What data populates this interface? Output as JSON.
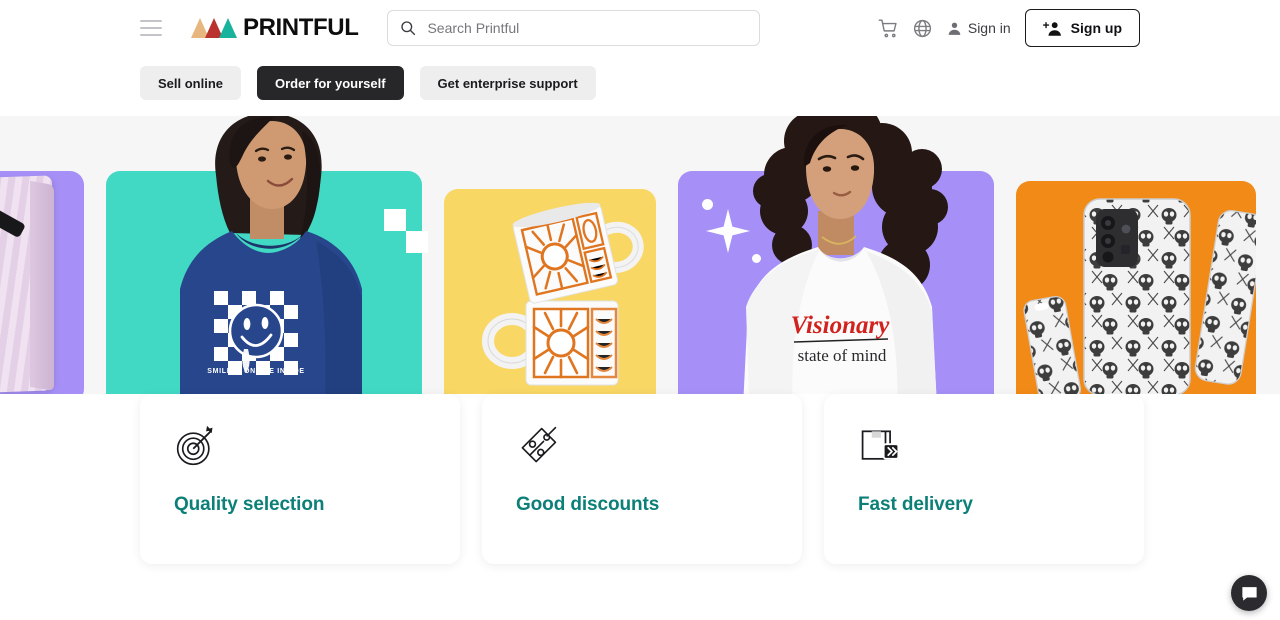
{
  "header": {
    "menu_icon": "hamburger-menu-icon",
    "brand": "PRINTFUL",
    "logo_colors": [
      "#e8b77f",
      "#b9322e",
      "#18b39c"
    ],
    "search": {
      "icon": "search-icon",
      "placeholder": "Search Printful",
      "value": ""
    },
    "cart_icon": "shopping-cart-icon",
    "globe_icon": "globe-icon",
    "sign_in": {
      "label": "Sign in",
      "icon": "user-icon"
    },
    "sign_up": {
      "label": "Sign up",
      "icon": "user-plus-icon"
    }
  },
  "tabs": [
    {
      "label": "Sell online",
      "active": false
    },
    {
      "label": "Order for yourself",
      "active": true
    },
    {
      "label": "Get enterprise support",
      "active": false
    }
  ],
  "carousel": {
    "items": [
      {
        "name": "tote-bag",
        "product": "Wavy pink tote bag with black straps",
        "bg_color": "#a690f7"
      },
      {
        "name": "smiley-sweatshirt",
        "product": "Navy sweatshirt with checkered melting smiley",
        "print_text": "SMILING ON THE INSIDE",
        "bg_color": "#41d9c4"
      },
      {
        "name": "sun-mugs",
        "product": "Stacked white mugs with orange sun print",
        "bg_color": "#f8d765"
      },
      {
        "name": "visionary-sweatshirt",
        "product": "White sweatshirt worn by model",
        "print_line1": "Visionary",
        "print_line2": "state of mind",
        "bg_color": "#a690f7"
      },
      {
        "name": "skull-phone-case",
        "product": "Phone case with skull pattern",
        "bg_color": "#f28a17"
      }
    ]
  },
  "features": {
    "heading_color": "#0c8078",
    "cards": [
      {
        "icon": "target-dartboard-icon",
        "title": "Quality selection"
      },
      {
        "icon": "discount-tag-icon",
        "title": "Good discounts"
      },
      {
        "icon": "fast-delivery-box-icon",
        "title": "Fast delivery"
      }
    ]
  },
  "chat_widget": {
    "icon": "chat-bubble-icon",
    "label": "Chat"
  }
}
